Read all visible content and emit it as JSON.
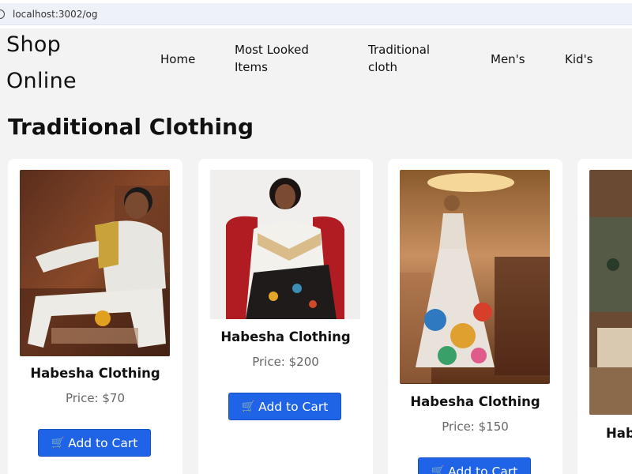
{
  "browser": {
    "url": "localhost:3002/og"
  },
  "header": {
    "logo_line1": "Shop",
    "logo_line2": "Online",
    "nav": {
      "home": "Home",
      "most_looked_1": "Most Looked",
      "most_looked_2": "Items",
      "traditional_1": "Traditional",
      "traditional_2": "cloth",
      "mens": "Men's",
      "kids": "Kid's"
    }
  },
  "main": {
    "title": "Traditional Clothing",
    "products": [
      {
        "name": "Habesha Clothing",
        "price": "Price: $70",
        "button": "Add to Cart"
      },
      {
        "name": "Habesha Clothing",
        "price": "Price: $200",
        "button": "Add to Cart"
      },
      {
        "name": "Habesha Clothing",
        "price": "Price: $150",
        "button": "Add to Cart"
      },
      {
        "name": "Hab"
      }
    ]
  },
  "icons": {
    "cart": "shopping-cart-icon",
    "info": "site-info-icon"
  },
  "colors": {
    "button": "#1f63e6",
    "page_bg": "#f3f3f3",
    "card_bg": "#ffffff"
  }
}
